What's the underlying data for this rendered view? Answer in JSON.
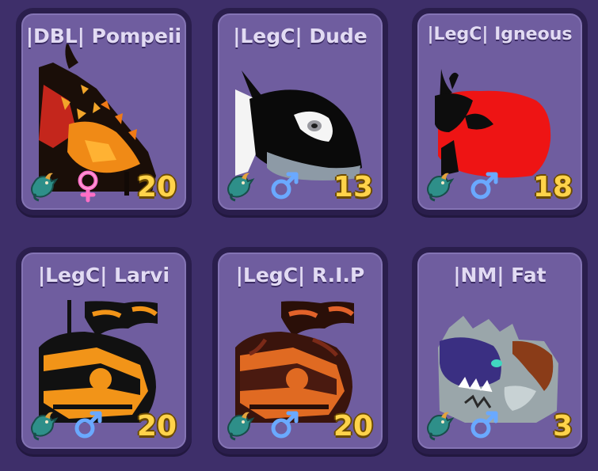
{
  "cards": [
    {
      "name": "|DBL| Pompeii",
      "level": "20",
      "gender": "female",
      "species_icon": "dragon-icon"
    },
    {
      "name": "|LegC| Dude",
      "level": "13",
      "gender": "male",
      "species_icon": "dragon-icon"
    },
    {
      "name": "|LegC| Igneous",
      "level": "18",
      "gender": "male",
      "species_icon": "dragon-icon"
    },
    {
      "name": "|LegC| Larvi",
      "level": "20",
      "gender": "male",
      "species_icon": "dragon-icon"
    },
    {
      "name": "|LegC| R.I.P",
      "level": "20",
      "gender": "male",
      "species_icon": "dragon-icon"
    },
    {
      "name": "|NM| Fat",
      "level": "3",
      "gender": "male",
      "species_icon": "dragon-icon"
    }
  ],
  "colors": {
    "background": "#3e2f6a",
    "card": "#6f5d9f",
    "level": "#ffd34a",
    "male": "#6aa9ff",
    "female": "#ff6fc6"
  }
}
